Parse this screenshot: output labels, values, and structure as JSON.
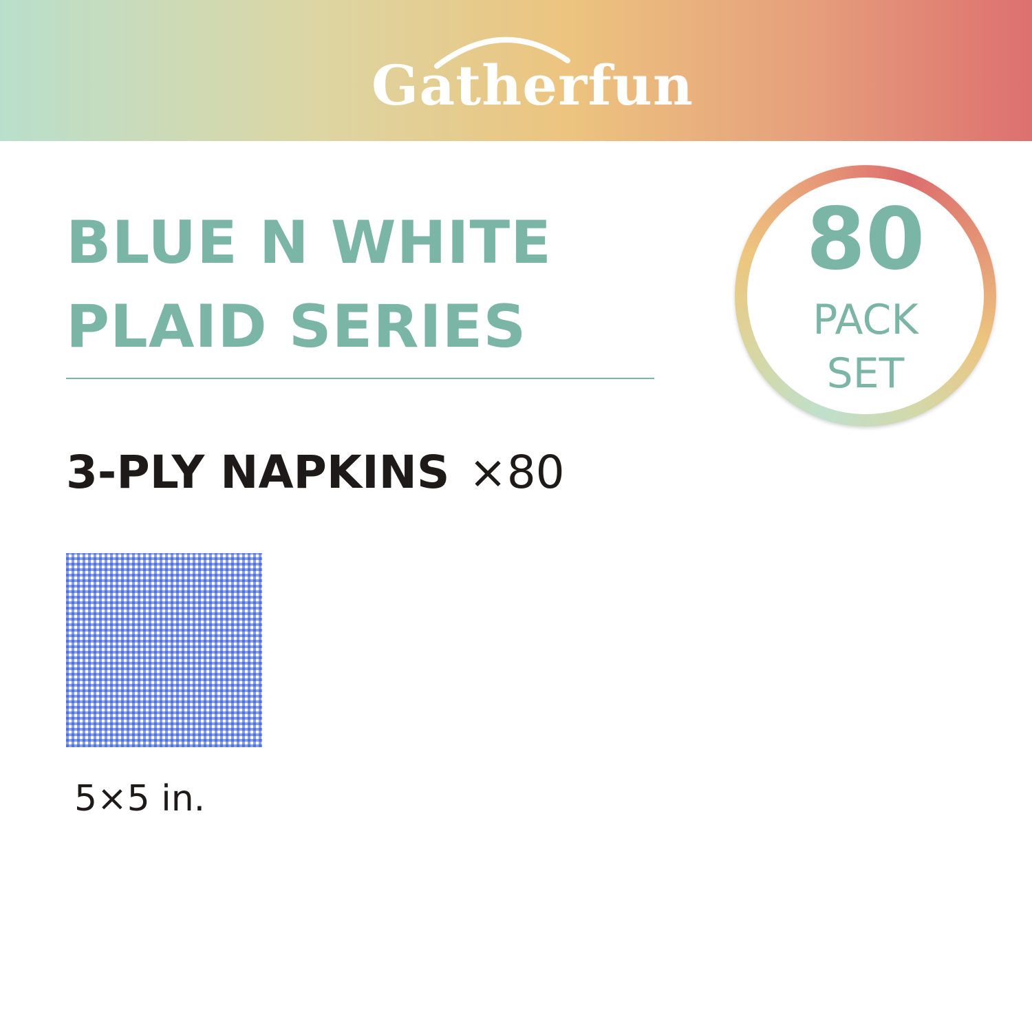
{
  "brand": {
    "name": "Gatherfun"
  },
  "title": {
    "line1": "BLUE N WHITE",
    "line2": "PLAID SERIES"
  },
  "badge": {
    "count": "80",
    "label_line1": "PACK",
    "label_line2": "SET"
  },
  "product": {
    "name": "3-PLY NAPKINS",
    "quantity": "×80",
    "size": "5×5 in."
  },
  "colors": {
    "accent": "#7ab5a5",
    "text_dark": "#1e1a1a",
    "plaid_blue": "#264fd3",
    "banner_start": "#b9dfcc",
    "banner_end": "#dd7070"
  }
}
